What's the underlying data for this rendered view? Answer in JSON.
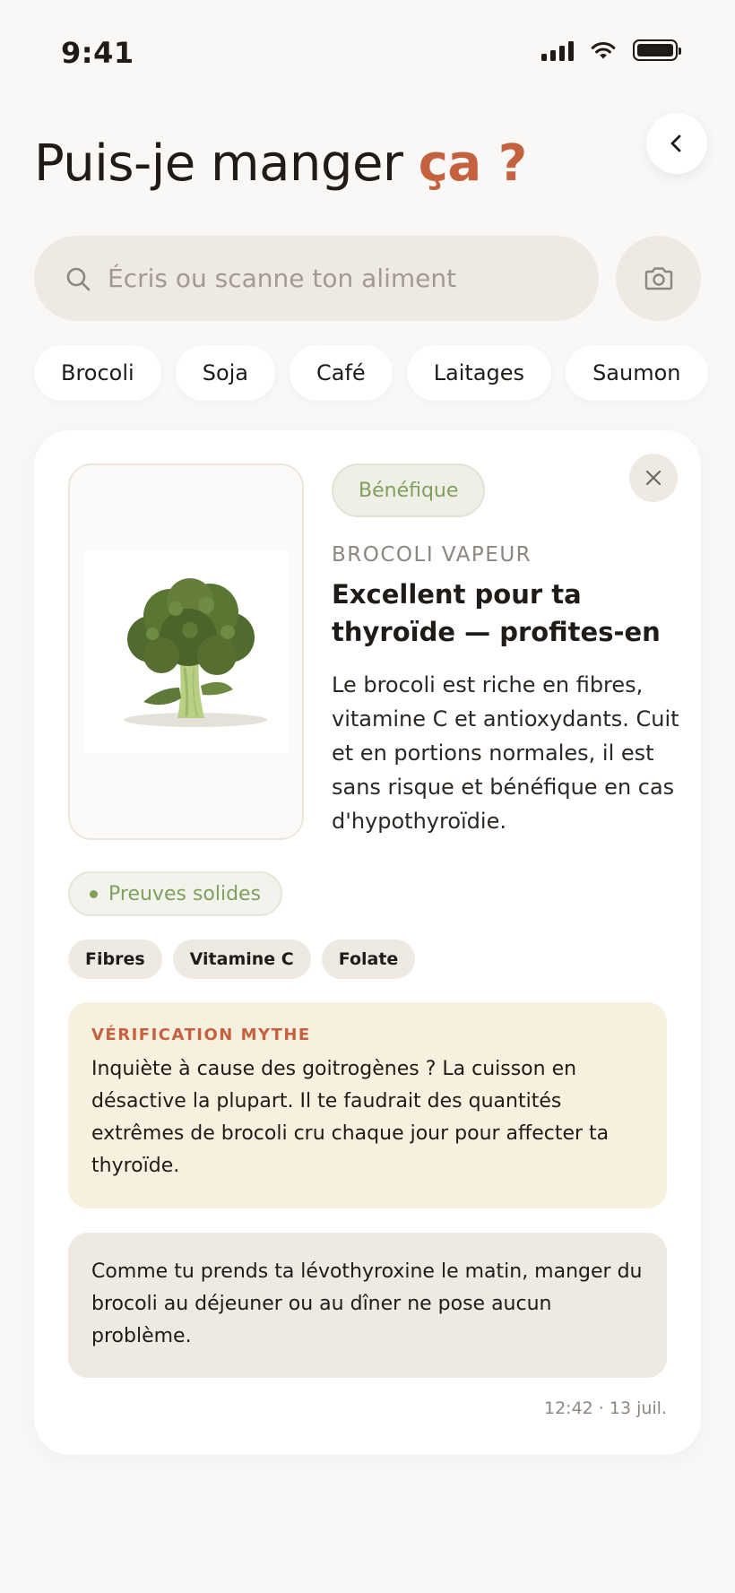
{
  "status_bar": {
    "time": "9:41"
  },
  "header": {
    "title_main": "Puis-je manger ",
    "title_accent": "ça ?"
  },
  "search": {
    "placeholder": "Écris ou scanne ton aliment",
    "value": ""
  },
  "chips": [
    "Brocoli",
    "Soja",
    "Café",
    "Laitages",
    "Saumon"
  ],
  "result_card": {
    "verdict": "Bénéfique",
    "food_name": "BROCOLI VAPEUR",
    "headline": "Excellent pour ta thyroïde — profites-en",
    "description": "Le brocoli est riche en fibres, vitamine C et antioxydants. Cuit et en portions normales, il est sans risque et bénéfique en cas d'hypothyroïdie.",
    "evidence": "Preuves solides",
    "nutrients": [
      "Fibres",
      "Vitamine C",
      "Folate"
    ],
    "myth": {
      "label": "VÉRIFICATION MYTHE",
      "text": "Inquiète à cause des goitrogènes ? La cuisson en désactive la plupart. Il te faudrait des quantités extrêmes de brocoli cru chaque jour pour affecter ta thyroïde."
    },
    "personal_note": "Comme tu prends ta lévothyroxine le matin, manger du brocoli au déjeuner ou au dîner ne pose aucun problème.",
    "timestamp": "12:42 · 13 juil."
  },
  "colors": {
    "accent": "#c4623f",
    "positive": "#7fa05c",
    "background": "#faf8f6",
    "myth_background": "#f8f0df"
  },
  "icons": {
    "back": "chevron-left-icon",
    "search": "search-icon",
    "camera": "camera-icon",
    "close": "close-icon",
    "food_image": "broccoli-image"
  }
}
